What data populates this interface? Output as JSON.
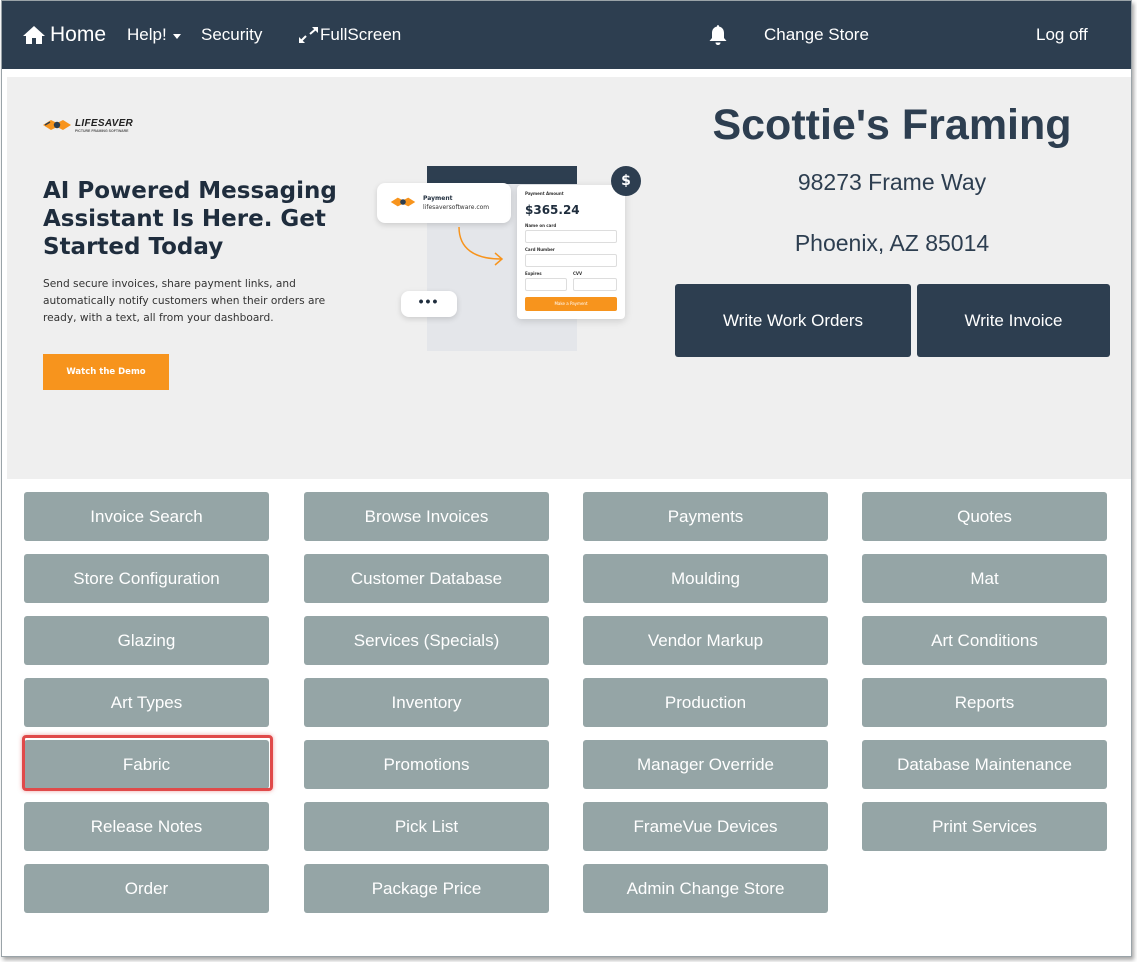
{
  "navbar": {
    "home_label": "Home",
    "help_label": "Help!",
    "security_label": "Security",
    "fullscreen_label": "FullScreen",
    "change_store_label": "Change Store",
    "logoff_label": "Log off",
    "icons": [
      "home-icon",
      "chevron-down-icon",
      "expand-icon",
      "bell-icon"
    ],
    "background_color": "#2d3e50"
  },
  "promo": {
    "logo_text": "LIFESAVER",
    "logo_subtext": "PICTURE FRAMING SOFTWARE",
    "headline": "AI Powered Messaging Assistant Is Here. Get Started Today",
    "body": "Send secure invoices, share payment links, and automatically notify customers when their orders are ready, with a text, all from your dashboard.",
    "demo_button": "Watch the Demo",
    "mock": {
      "payment_title": "Payment",
      "payment_site": "lifesaversoftware.com",
      "amount_label": "Payment Amount",
      "amount": "$365.24",
      "name_label": "Name on card",
      "card_label": "Card Number",
      "expires_label": "Expires",
      "cvv_label": "CVV",
      "pay_button": "Make a Payment",
      "dollar_glyph": "$",
      "dots": "•••"
    },
    "accent_color": "#f7941d"
  },
  "store": {
    "name": "Scottie's Framing",
    "street": "98273 Frame Way",
    "city": "Phoenix, AZ 85014",
    "write_work_orders": "Write Work Orders",
    "write_invoice": "Write Invoice"
  },
  "menu": {
    "button_color": "#95a5a6",
    "highlight_color": "#e04a4a",
    "highlighted_item": "Fabric",
    "items": [
      "Invoice Search",
      "Browse Invoices",
      "Payments",
      "Quotes",
      "Store Configuration",
      "Customer Database",
      "Moulding",
      "Mat",
      "Glazing",
      "Services (Specials)",
      "Vendor Markup",
      "Art Conditions",
      "Art Types",
      "Inventory",
      "Production",
      "Reports",
      "Fabric",
      "Promotions",
      "Manager Override",
      "Database Maintenance",
      "Release Notes",
      "Pick List",
      "FrameVue Devices",
      "Print Services",
      "Order",
      "Package Price",
      "Admin Change Store"
    ]
  }
}
